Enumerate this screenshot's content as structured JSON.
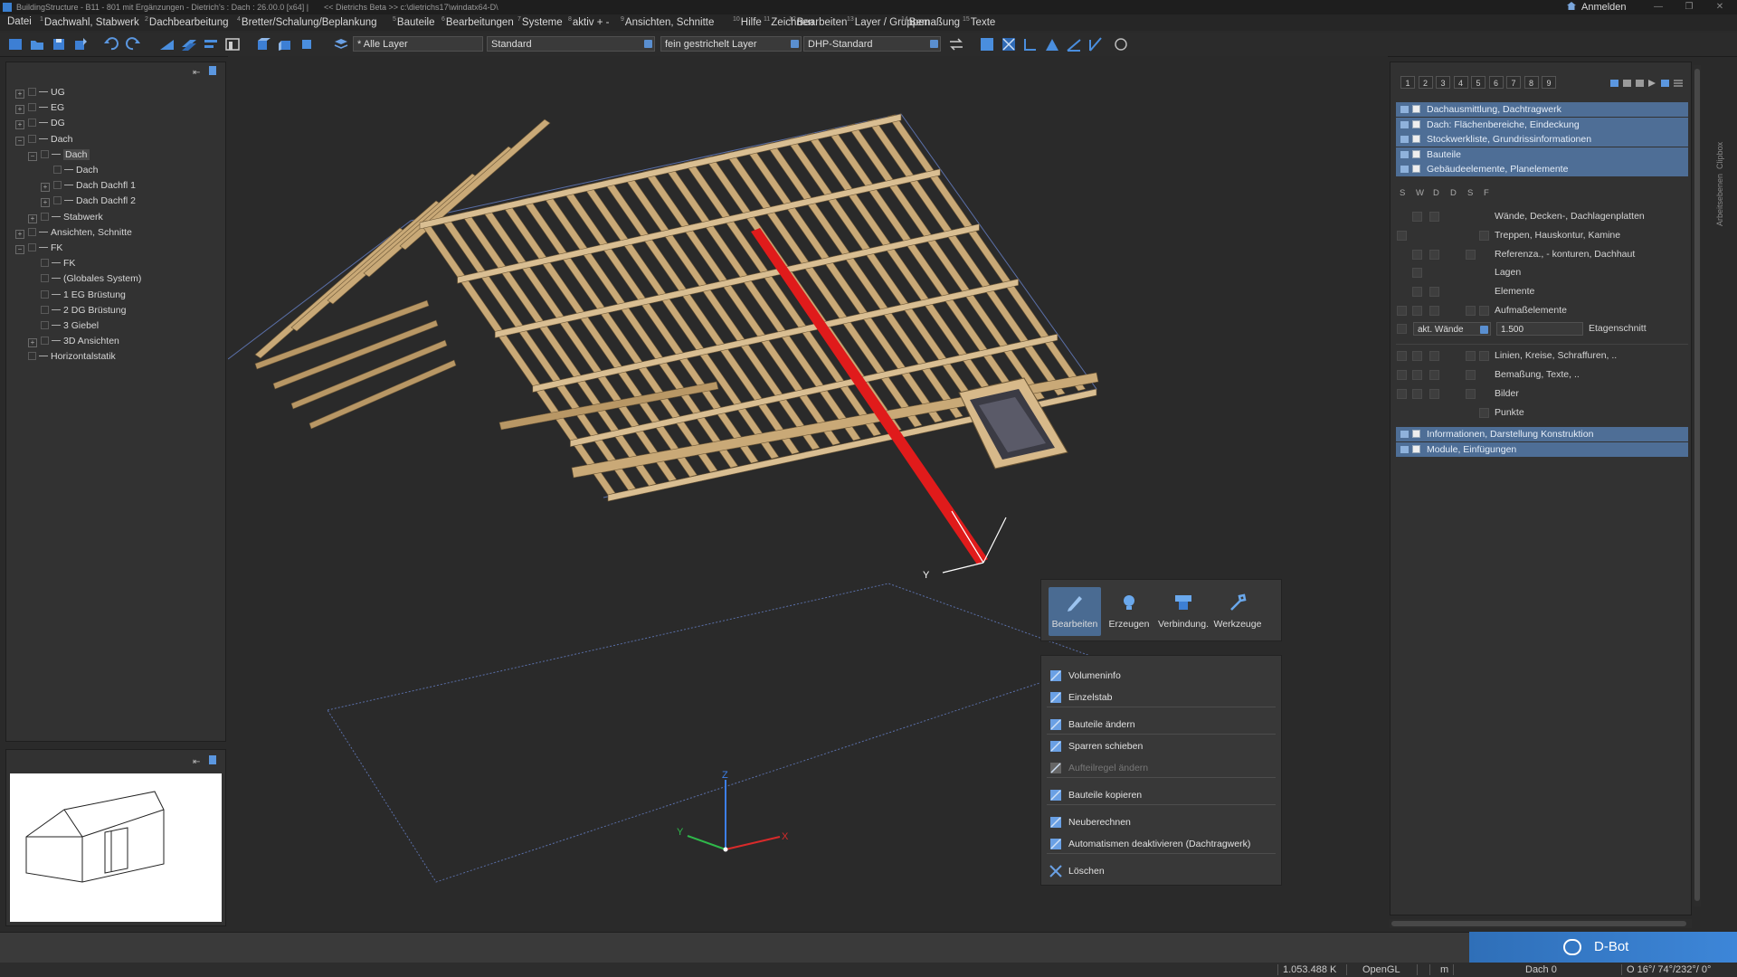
{
  "titlebar": {
    "title": "BuildingStructure - B11 - 801 mit Ergänzungen - Dietrich's : Dach : 26.00.0 [x64] |",
    "path": "<< Dietrichs Beta >> c:\\dietrichs17\\windatx64-D\\",
    "login": "Anmelden"
  },
  "menu": [
    {
      "num": "",
      "label": "Datei"
    },
    {
      "num": "1",
      "label": "Dachwahl, Stabwerk"
    },
    {
      "num": "2",
      "label": "Dachbearbeitung"
    },
    {
      "num": "4",
      "label": "Bretter/Schalung/Beplankung"
    },
    {
      "num": "5",
      "label": "Bauteile"
    },
    {
      "num": "6",
      "label": "Bearbeitungen"
    },
    {
      "num": "7",
      "label": "Systeme"
    },
    {
      "num": "8",
      "label": "aktiv + -"
    },
    {
      "num": "9",
      "label": "Ansichten, Schnitte"
    },
    {
      "num": "10",
      "label": "Hilfe"
    },
    {
      "num": "11",
      "label": "Zeichnen"
    },
    {
      "num": "12",
      "label": "Bearbeiten"
    },
    {
      "num": "13",
      "label": "Layer / Gruppen"
    },
    {
      "num": "14",
      "label": "Bemaßung"
    },
    {
      "num": "15",
      "label": "Texte"
    }
  ],
  "toolbar": {
    "layer_combo": "* Alle Layer",
    "style_combo": "Standard",
    "line_combo": "fein gestrichelt Layer",
    "standard_combo": "DHP-Standard"
  },
  "tree": [
    {
      "label": "UG",
      "level": 0,
      "exp": "+"
    },
    {
      "label": "EG",
      "level": 0,
      "exp": "+"
    },
    {
      "label": "DG",
      "level": 0,
      "exp": "+"
    },
    {
      "label": "Dach",
      "level": 0,
      "exp": "−"
    },
    {
      "label": "Dach",
      "level": 1,
      "exp": "−",
      "selected": true
    },
    {
      "label": "Dach",
      "level": 2,
      "exp": ""
    },
    {
      "label": "Dach Dachfl 1",
      "level": 2,
      "exp": "+"
    },
    {
      "label": "Dach Dachfl 2",
      "level": 2,
      "exp": "+"
    },
    {
      "label": "Stabwerk",
      "level": 1,
      "exp": "+"
    },
    {
      "label": "Ansichten, Schnitte",
      "level": 0,
      "exp": "+"
    },
    {
      "label": "FK",
      "level": 0,
      "exp": "−"
    },
    {
      "label": "FK",
      "level": 1,
      "exp": ""
    },
    {
      "label": "(Globales System)",
      "level": 1,
      "exp": ""
    },
    {
      "label": "1 EG Brüstung",
      "level": 1,
      "exp": ""
    },
    {
      "label": "2 DG Brüstung",
      "level": 1,
      "exp": ""
    },
    {
      "label": "3 Giebel",
      "level": 1,
      "exp": ""
    },
    {
      "label": "3D Ansichten",
      "level": 1,
      "exp": "+"
    },
    {
      "label": "Horizontalstatik",
      "level": 0,
      "exp": ""
    }
  ],
  "layer_tabs": [
    "1",
    "2",
    "3",
    "4",
    "5",
    "6",
    "7",
    "8",
    "9"
  ],
  "layer_groups_top": [
    "Dachausmittlung, Dachtragwerk",
    "Dach: Flächenbereiche, Eindeckung",
    "Stockwerkliste, Grundrissinformationen",
    "Bauteile",
    "Gebäudeelemente, Planelemente"
  ],
  "layer_columns": [
    "S",
    "W",
    "D",
    "D",
    "S",
    "F"
  ],
  "layer_rows_1": [
    "Wände, Decken-, Dachlagenplatten",
    "Treppen, Hauskontur, Kamine",
    "Referenza., - konturen, Dachhaut",
    "Lagen",
    "Elemente",
    "Aufmaßelemente"
  ],
  "etagen": {
    "combo": "akt. Wände",
    "value": "1.500",
    "label": "Etagenschnitt"
  },
  "layer_rows_2": [
    "Linien, Kreise, Schraffuren, ..",
    "Bemaßung, Texte, ..",
    "Bilder",
    "Punkte"
  ],
  "layer_groups_bottom": [
    "Informationen, Darstellung Konstruktion",
    "Module, Einfügungen"
  ],
  "side_tabs": [
    "Arbeitsebenen",
    "Clipbox"
  ],
  "context_tabs": [
    "Bearbeiten",
    "Erzeugen",
    "Verbindung.",
    "Werkzeuge"
  ],
  "context_menu": {
    "items": [
      {
        "label": "Volumeninfo",
        "disabled": false
      },
      {
        "label": "Einzelstab",
        "disabled": false
      },
      {
        "label": "Bauteile ändern",
        "disabled": false
      },
      {
        "label": "Sparren schieben",
        "disabled": false
      },
      {
        "label": "Aufteilregel ändern",
        "disabled": true
      },
      {
        "label": "Bauteile kopieren",
        "disabled": false
      },
      {
        "label": "Neuberechnen",
        "disabled": false
      },
      {
        "label": "Automatismen deaktivieren (Dachtragwerk)",
        "disabled": false
      },
      {
        "label": "Löschen",
        "disabled": false
      }
    ]
  },
  "axes": {
    "x": "X",
    "y": "Y",
    "z": "Z"
  },
  "dbot": "D-Bot",
  "status": {
    "memory": "1.053.488 K",
    "renderer": "OpenGL",
    "unit": "m",
    "layer": "Dach 0",
    "view": "O 16°/ 74°/232°/  0°"
  },
  "colors": {
    "accent": "#4e6e96",
    "timber": "#c9a977",
    "highlight": "#e01b1b",
    "dbot": "#3d86d8"
  }
}
